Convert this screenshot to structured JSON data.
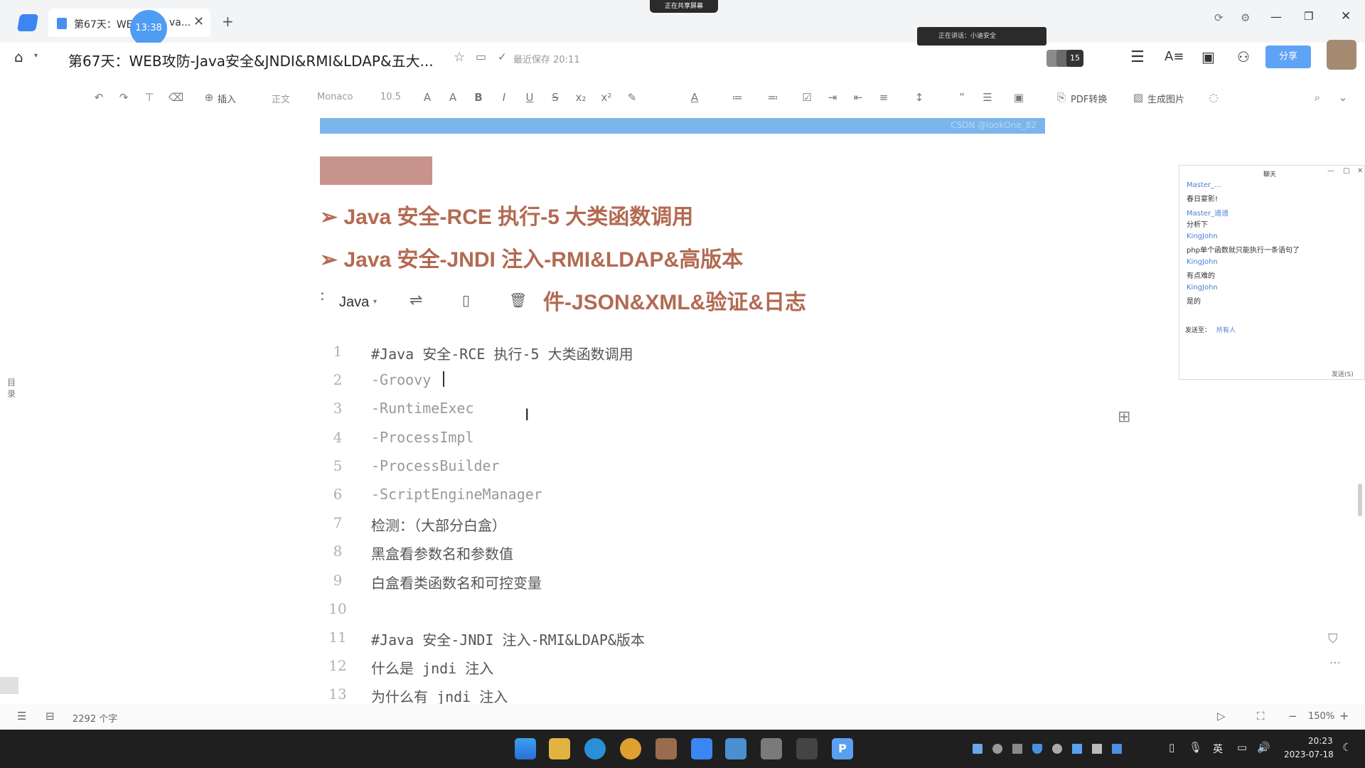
{
  "tab": {
    "title": "第67天：WE",
    "title_tail": "va...",
    "timer_badge": "13:38"
  },
  "recording_badge": "正在共享屏幕",
  "header": {
    "doc_title": "第67天：WEB攻防-Java安全&JNDI&RMI&LDAP&五大...",
    "saved_status": "最近保存 20:11",
    "share_button": "分享",
    "avatar_count": "15"
  },
  "voice_bar": {
    "text": "正在讲话：小迪安全"
  },
  "toolbar": {
    "insert": "插入",
    "style": "正文",
    "font": "Monaco",
    "size": "10.5",
    "pdf": "PDF转换",
    "image": "生成图片"
  },
  "doc": {
    "banner_text": "CSDN @lookOne_82",
    "headings": [
      "➢ Java 安全-RCE 执行-5 大类函数调用",
      "➢ Java 安全-JNDI 注入-RMI&LDAP&高版本"
    ],
    "code_toolbar": {
      "lang": "Java",
      "heading_partial": "件-JSON&XML&验证&日志"
    },
    "code_lines": [
      {
        "n": "1",
        "text": "#Java 安全-RCE 执行-5 大类函数调用",
        "color": "#555555"
      },
      {
        "n": "2",
        "text": "-Groovy",
        "color": "#999999"
      },
      {
        "n": "3",
        "text": "-RuntimeExec",
        "color": "#999999"
      },
      {
        "n": "4",
        "text": "-ProcessImpl",
        "color": "#999999"
      },
      {
        "n": "5",
        "text": "-ProcessBuilder",
        "color": "#999999"
      },
      {
        "n": "6",
        "text": "-ScriptEngineManager",
        "color": "#999999"
      },
      {
        "n": "7",
        "text": "检测：（大部分白盒）",
        "color": "#555555"
      },
      {
        "n": "8",
        "text": "黑盒看参数名和参数值",
        "color": "#555555"
      },
      {
        "n": "9",
        "text": "白盒看类函数名和可控变量",
        "color": "#555555"
      },
      {
        "n": "10",
        "text": "",
        "color": "#555555"
      },
      {
        "n": "11",
        "text": "#Java 安全-JNDI 注入-RMI&LDAP&版本",
        "color": "#555555"
      },
      {
        "n": "12",
        "text": "什么是 jndi 注入",
        "color": "#555555"
      },
      {
        "n": "13",
        "text": "为什么有 jndi 注入",
        "color": "#555555"
      }
    ],
    "toc_label": "目录"
  },
  "chat": {
    "title": "聊天",
    "messages": [
      {
        "name": "Master_...",
        "msg": "春日宴影!"
      },
      {
        "name": "Master_迪迪",
        "msg": "分析下"
      },
      {
        "name": "KingJohn",
        "msg": "php单个函数就只能执行一条语句了"
      },
      {
        "name": "KingJohn",
        "msg": "有点难的"
      },
      {
        "name": "KingJohn",
        "msg": "是的"
      }
    ],
    "send_to_label": "发送至：",
    "send_to_value": "所有人",
    "send_button": "发送(S)"
  },
  "status": {
    "word_count": "2292 个字",
    "zoom": "150%"
  },
  "taskbar": {
    "time": "20:23",
    "date": "2023-07-18",
    "ime": "英"
  }
}
